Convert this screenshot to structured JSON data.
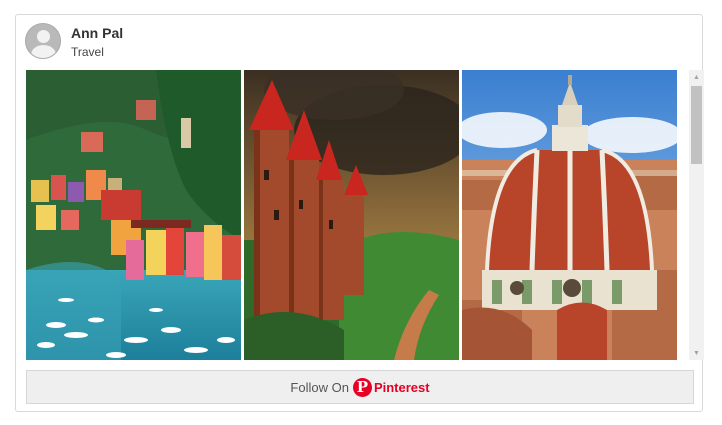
{
  "profile": {
    "name": "Ann Pal",
    "board": "Travel"
  },
  "pins": [
    {
      "subject": "colorful-harbor-village"
    },
    {
      "subject": "red-castle-under-storm-sky"
    },
    {
      "subject": "cathedral-dome-over-city"
    }
  ],
  "follow_button": {
    "prefix": "Follow On",
    "brand": "Pinterest",
    "brand_color": "#e60023"
  },
  "icons": {
    "avatar": "user-silhouette-icon",
    "logo": "pinterest-logo-icon",
    "scroll_up": "arrow-up-icon",
    "scroll_down": "arrow-down-icon"
  }
}
